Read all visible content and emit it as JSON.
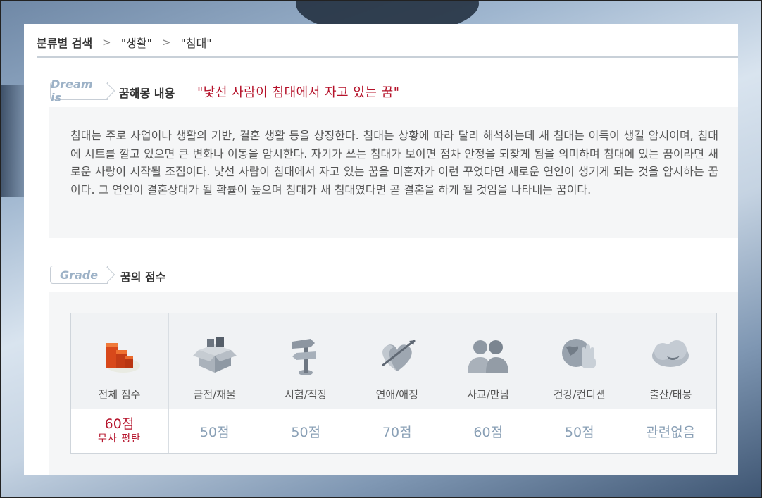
{
  "breadcrumb": {
    "root": "분류별 검색",
    "sep": ">",
    "level1": "\"생활\"",
    "level2": "\"침대\""
  },
  "dream_section": {
    "tag": "Dream is",
    "title": "꿈해몽 내용",
    "dream_title": "\"낯선 사람이 침대에서 자고 있는 꿈\"",
    "content": "침대는 주로 사업이나 생활의 기반, 결혼 생활 등을 상징한다. 침대는 상황에 따라 달리 해석하는데 새 침대는 이득이 생길 암시이며, 침대에 시트를 깔고 있으면 큰 변화나 이동을 암시한다. 자기가 쓰는 침대가 보이면 점차 안정을 되찾게 됨을 의미하며 침대에 있는 꿈이라면 새로운 사랑이 시작될 조짐이다. 낯선 사람이 침대에서 자고 있는 꿈을 미혼자가 이런 꾸었다면 새로운 연인이 생기게 되는 것을 암시하는 꿈이다. 그 연인이 결혼상대가 될 확률이 높으며 침대가 새 침대였다면 곧 결혼을 하게 될 것임을 나타내는 꿈이다."
  },
  "grade_section": {
    "tag": "Grade",
    "title": "꿈의 점수",
    "total": {
      "label": "전체 점수",
      "score": "60점",
      "verdict": "무사 평탄",
      "icon": "total-blocks-icon"
    },
    "categories": [
      {
        "label": "금전/재물",
        "score": "50점",
        "icon": "money-box-icon"
      },
      {
        "label": "시험/직장",
        "score": "50점",
        "icon": "signpost-icon"
      },
      {
        "label": "연애/애정",
        "score": "70점",
        "icon": "heart-arrow-icon"
      },
      {
        "label": "사교/만남",
        "score": "60점",
        "icon": "people-icon"
      },
      {
        "label": "건강/컨디션",
        "score": "50점",
        "icon": "globe-hand-icon"
      },
      {
        "label": "출산/태몽",
        "score": "관련없음",
        "icon": "moon-cloud-icon"
      }
    ]
  },
  "colors": {
    "accent_red": "#b5122a",
    "score_blue": "#8aa0b6",
    "tag_text": "#9db2c7"
  }
}
